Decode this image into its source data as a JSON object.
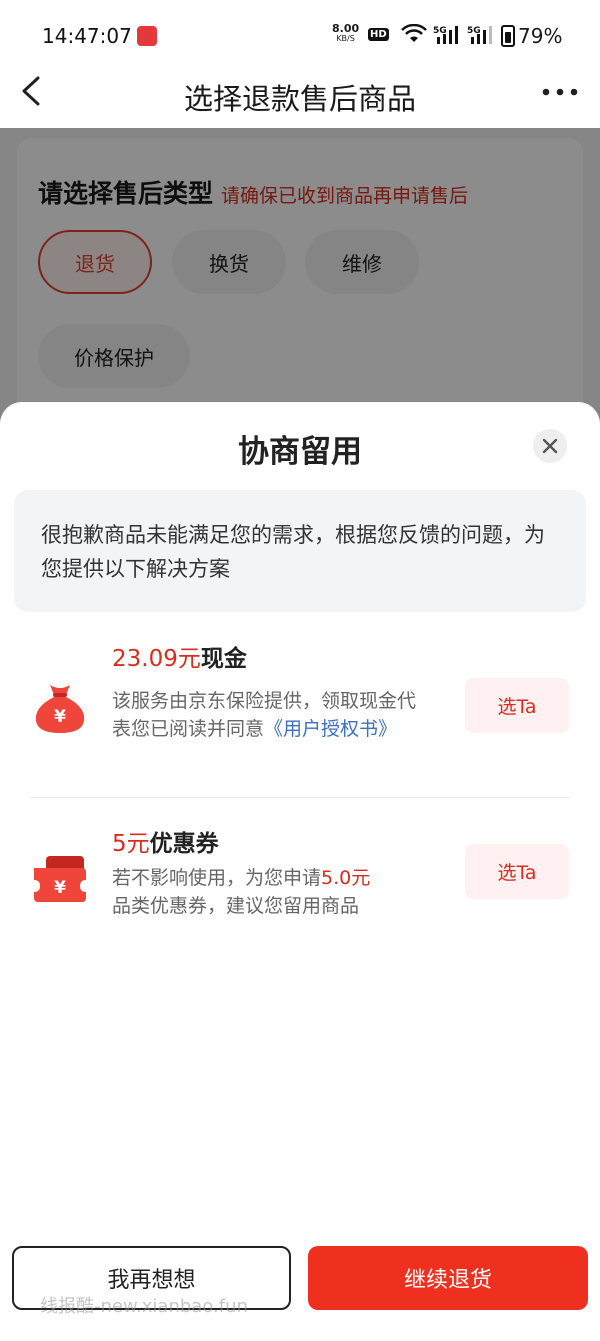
{
  "status_bar": {
    "time": "14:47:07",
    "net_speed": "8.00",
    "net_unit": "KB/S",
    "hd_badge": "HD",
    "sim1": "5G",
    "sim2": "5G",
    "battery": "79%"
  },
  "nav": {
    "title": "选择退款售后商品"
  },
  "background_page": {
    "heading": "请选择售后类型",
    "note": "请确保已收到商品再申请售后",
    "types": [
      {
        "label": "退货",
        "selected": true
      },
      {
        "label": "换货",
        "selected": false
      },
      {
        "label": "维修",
        "selected": false
      },
      {
        "label": "价格保护",
        "selected": false
      }
    ]
  },
  "sheet": {
    "title": "协商留用",
    "notice": "很抱歉商品未能满足您的需求，根据您反馈的问题，为您提供以下解决方案",
    "options": [
      {
        "icon": "money-bag-icon",
        "amount": "23.09元",
        "kind": "现金",
        "desc_prefix": "该服务由京东保险提供，领取现金代表您已阅读并同意",
        "desc_link": "《用户授权书》",
        "button": "选Ta"
      },
      {
        "icon": "coupon-icon",
        "amount": "5元",
        "kind": "优惠券",
        "desc_prefix": "若不影响使用，为您申请",
        "desc_highlight": "5.0元",
        "desc_suffix": "品类优惠券，建议您留用商品",
        "button": "选Ta"
      }
    ]
  },
  "footer": {
    "secondary": "我再想想",
    "primary": "继续退货"
  },
  "watermark": "线报酷-new.xianbao.fun",
  "colors": {
    "accent": "#f0301f",
    "price_red": "#d82c1c",
    "link_blue": "#3d6fc2"
  }
}
